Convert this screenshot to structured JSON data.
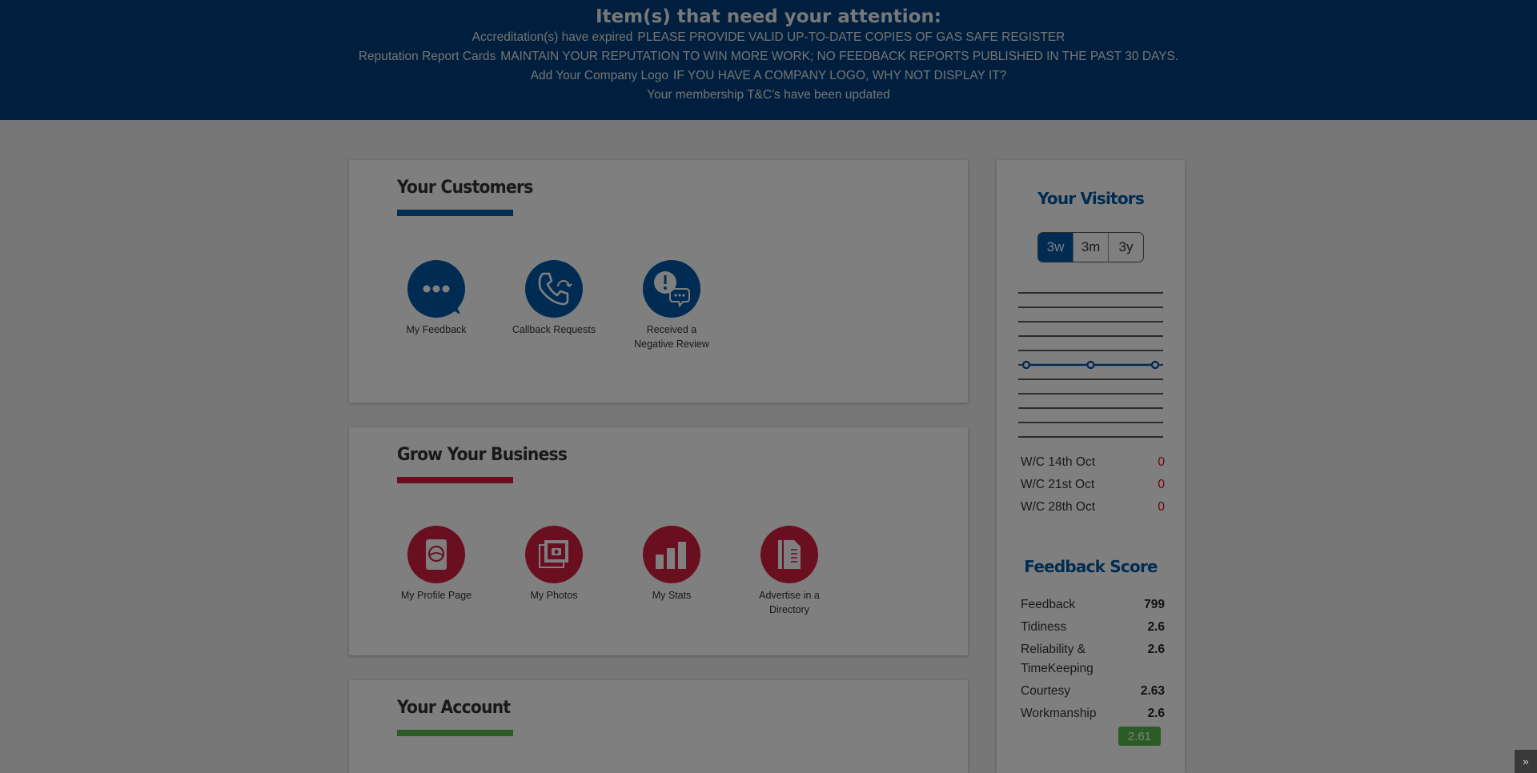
{
  "attention": {
    "title": "Item(s) that need your attention:",
    "items": [
      {
        "label": "Accreditation(s) have expired",
        "hint": "PLEASE PROVIDE VALID UP-TO-DATE COPIES OF GAS SAFE REGISTER"
      },
      {
        "label": "Reputation Report Cards",
        "hint": "MAINTAIN YOUR REPUTATION TO WIN MORE WORK; NO FEEDBACK REPORTS PUBLISHED IN THE PAST 30 DAYS."
      },
      {
        "label": "Add Your Company Logo",
        "hint": "IF YOU HAVE A COMPANY LOGO, WHY NOT DISPLAY IT?"
      },
      {
        "label": "Your membership T&C's have been updated",
        "hint": ""
      }
    ]
  },
  "customers": {
    "title": "Your Customers",
    "accent": "#0059a7",
    "tiles": [
      {
        "label": "My Feedback",
        "icon": "speech-bubble-icon"
      },
      {
        "label": "Callback Requests",
        "icon": "phone-callback-icon"
      },
      {
        "label": "Received a Negative Review",
        "icon": "alert-chat-icon"
      }
    ]
  },
  "grow": {
    "title": "Grow Your Business",
    "accent": "#d31f3e",
    "tiles": [
      {
        "label": "My Profile Page",
        "icon": "profile-page-icon"
      },
      {
        "label": "My Photos",
        "icon": "photos-icon"
      },
      {
        "label": "My Stats",
        "icon": "bar-chart-icon"
      },
      {
        "label": "Advertise in a Directory",
        "icon": "directory-icon"
      }
    ]
  },
  "account": {
    "title": "Your Account",
    "accent": "#58b84b"
  },
  "visitors": {
    "title": "Your Visitors",
    "ranges": [
      "3w",
      "3m",
      "3y"
    ],
    "active_range": "3w",
    "weeks": [
      {
        "label": "W/C 14th Oct",
        "value": "0"
      },
      {
        "label": "W/C 21st Oct",
        "value": "0"
      },
      {
        "label": "W/C 28th Oct",
        "value": "0"
      }
    ]
  },
  "chart_data": {
    "type": "line",
    "categories": [
      "W/C 14th Oct",
      "W/C 21st Oct",
      "W/C 28th Oct"
    ],
    "series": [
      {
        "values": [
          0,
          0,
          0
        ]
      }
    ],
    "grid": true
  },
  "feedback_score": {
    "title": "Feedback Score",
    "rows": [
      {
        "label": "Feedback",
        "value": "799"
      },
      {
        "label": "Tidiness",
        "value": "2.6"
      },
      {
        "label": "Reliability & TimeKeeping",
        "value": "2.6"
      },
      {
        "label": "Courtesy",
        "value": "2.63"
      },
      {
        "label": "Workmanship",
        "value": "2.6"
      }
    ],
    "overall": "2.61"
  },
  "scroll_top_icon": "double-chevron-up-icon"
}
